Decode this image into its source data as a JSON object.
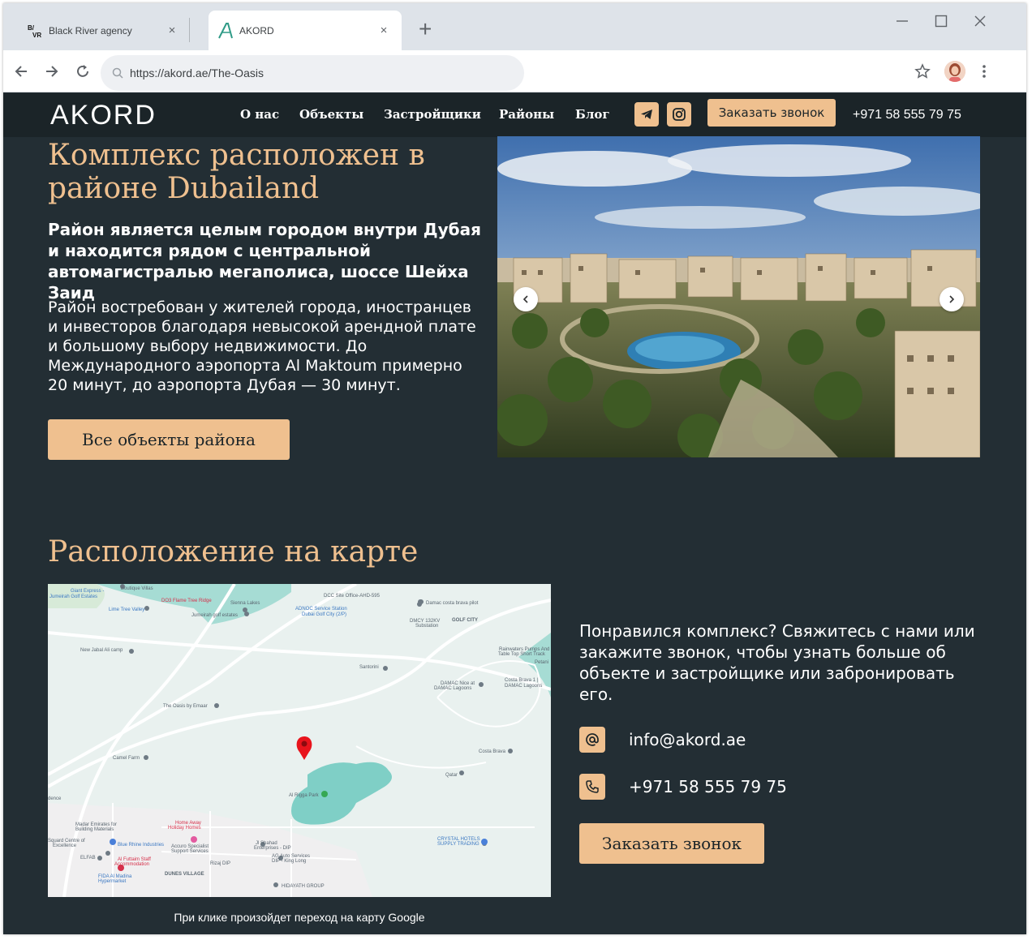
{
  "browser": {
    "tabs": [
      {
        "title": "Black River agency",
        "favicon_text": "B/VR"
      },
      {
        "title": "AKORD",
        "favicon_text": "A"
      }
    ],
    "address": "https://akord.ae/The-Oasis",
    "tab_close_glyph": "×",
    "new_tab_glyph": "+",
    "minimize_glyph": "—",
    "maximize_glyph": "☐",
    "close_glyph": "✕"
  },
  "site": {
    "logo": "AKORD",
    "nav": [
      "О нас",
      "Объекты",
      "Застройщики",
      "Районы",
      "Блог"
    ],
    "header_call": "Заказать звонок",
    "header_phone": "+971 58 555 79 75"
  },
  "district": {
    "headline": "Комплекс расположен в районе Dubailand",
    "subhead": "Район является целым городом внутри Дубая и находится рядом с центральной автомагистралью мегаполиса, шоссе Шейха Заид",
    "paragraph": "Район востребован у жителей города, иностранцев и инвесторов благодаря невысокой арендной плате и большому выбору недвижимости. До Международного аэропорта Al Maktoum примерно 20 минут, до аэропорта Дубая — 30 минут.",
    "button": "Все объекты района"
  },
  "map_section": {
    "title": "Расположение на карте",
    "note": "При клике произойдет переход на карту Google",
    "labels": [
      "Giant Express - Jumeirah Golf Estates",
      "Boutique Villas",
      "DO3 Flame Tree Ridge",
      "Sienna Lakes",
      "DCC Site Office-AHD-595",
      "Damac costa brava pilot",
      "Lime Tree Valley",
      "ADNOC Service Station Dubai Golf City",
      "Jumeirah golf estates",
      "DMCY 132KV Substation",
      "GOLF CITY",
      "New Jabal Ali camp",
      "Rainwaters Pumps And Table Top Short Track",
      "Petani",
      "Santorini",
      "DAMAC Nice at DAMAC Lagoons",
      "Costa Brava 1 | DAMAC Lagoons",
      "The Oasis by Emaar",
      "Camel Farm",
      "Costa Brava",
      "Qatar",
      "Al Rigga Park",
      "dence",
      "Home Away Holiday Homes",
      "Madar Emirates for Building Materials",
      "Jl Shahad Enterprises - DIP",
      "Squard Centre of Excellence",
      "Blue Rhine Industries",
      "Accuro Specialist Support Services",
      "AG Auto Services DIP - King Long",
      "CRYSTAL HOTELS SUPPLY TRADING",
      "ELFAB",
      "Al Futtaim Staff Accommodation",
      "Rizaj DIP",
      "DUNES VILLAGE",
      "FIDA Al Madina Hypermarket",
      "HIDAYATH GROUP"
    ]
  },
  "cta": {
    "text": "Понравился комплекс? Свяжитесь с нами или закажите звонок, чтобы узнать больше об объекте и застройщике или забронировать его.",
    "email": "info@akord.ae",
    "phone": "+971 58 555 79 75",
    "button": "Заказать звонок"
  },
  "colors": {
    "accent": "#efc08f",
    "background": "#232e34",
    "header": "#1b2428"
  }
}
